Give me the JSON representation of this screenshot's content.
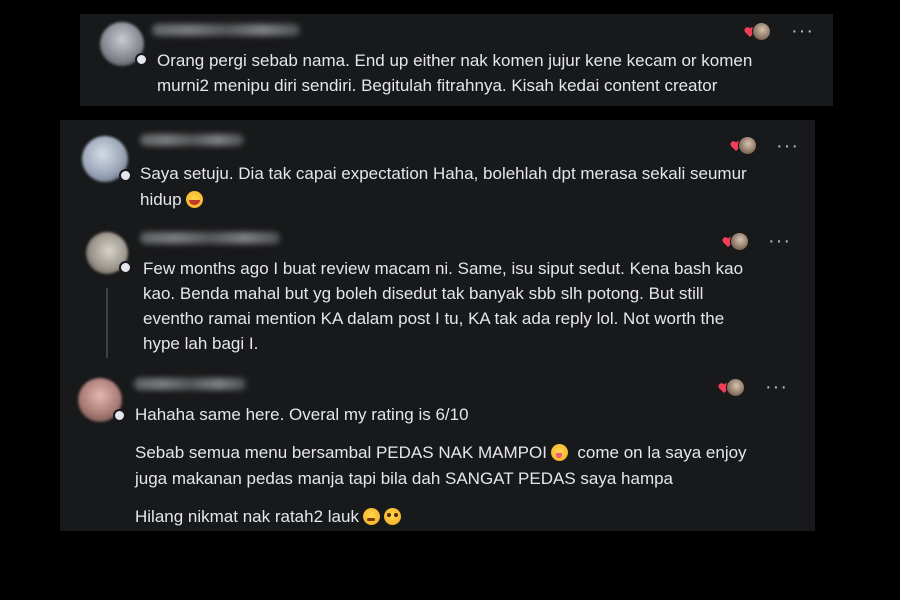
{
  "colors": {
    "background": "#000000",
    "card": "#18191a",
    "text": "#e4e6eb",
    "muted": "#b0b3b8",
    "love_reaction": "#f33e58"
  },
  "comments": [
    {
      "lines": [
        "Orang pergi sebab nama. End up either nak komen jujur kene kecam or komen",
        "murni2 menipu diri sendiri. Begitulah fitrahnya. Kisah kedai content creator"
      ],
      "reaction_icon": "heart-icon",
      "more_icon": "more-options-icon"
    },
    {
      "lines": [
        "Saya setuju. Dia tak capai expectation Haha, bolehlah dpt merasa sekali seumur",
        "hidup"
      ],
      "emoji": "grinning-face-icon",
      "reaction_icon": "heart-icon",
      "more_icon": "more-options-icon"
    },
    {
      "lines": [
        "Few months ago I buat review macam ni. Same, isu siput sedut. Kena bash kao",
        "kao. Benda mahal but yg boleh disedut tak banyak sbb slh potong. But still",
        "eventho ramai mention KA dalam post I tu, KA tak ada reply lol. Not worth the",
        "hype lah bagi I."
      ],
      "reaction_icon": "heart-icon",
      "more_icon": "more-options-icon"
    },
    {
      "lines": [
        "Hahaha same here. Overal my rating is 6/10",
        "Sebab semua menu bersambal PEDAS NAK MAMPOI",
        "come on la saya enjoy",
        "juga makanan pedas manja tapi bila dah SANGAT PEDAS saya hampa",
        "Hilang nikmat nak ratah2 lauk"
      ],
      "emojis": [
        "zany-face-icon",
        "yum-face-icon",
        "pleading-face-icon"
      ],
      "reaction_icon": "heart-icon",
      "more_icon": "more-options-icon"
    }
  ],
  "more_label": "···"
}
